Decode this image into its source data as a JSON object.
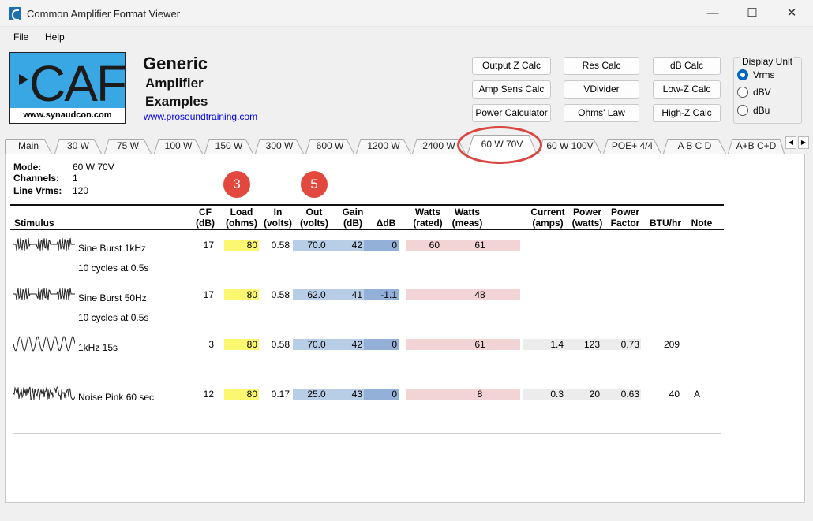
{
  "window": {
    "title": "Common Amplifier Format Viewer",
    "minimize": "—",
    "maximize": "☐",
    "close": "✕"
  },
  "menu": {
    "file": "File",
    "help": "Help"
  },
  "logo": {
    "letters": "CAF",
    "site": "www.synaudcon.com"
  },
  "heading": {
    "line1": "Generic",
    "line2": "Amplifier",
    "line3": "Examples",
    "link": "www.prosoundtraining.com"
  },
  "calc_buttons": [
    "Output Z Calc",
    "Res Calc",
    "dB Calc",
    "Amp Sens Calc",
    "VDivider",
    "Low-Z Calc",
    "Power Calculator",
    "Ohms' Law",
    "High-Z Calc"
  ],
  "display_unit": {
    "title": "Display Unit",
    "options": [
      "Vrms",
      "dBV",
      "dBu"
    ],
    "selected": "Vrms"
  },
  "tabs": [
    "Main",
    "30 W",
    "75 W",
    "100 W",
    "150 W",
    "300 W",
    "600 W",
    "1200 W",
    "2400 W",
    "60 W 70V",
    "60 W 100V",
    "POE+ 4/4",
    "A B C D",
    "A+B C+D"
  ],
  "active_tab": "60 W 70V",
  "meta": {
    "mode_label": "Mode:",
    "mode": "60 W 70V",
    "channels_label": "Channels:",
    "channels": "1",
    "line_label": "Line Vrms:",
    "line": "120"
  },
  "badges": [
    "3",
    "5"
  ],
  "columns": {
    "stimulus": "Stimulus",
    "cf": [
      "CF",
      "(dB)"
    ],
    "load": [
      "Load",
      "(ohms)"
    ],
    "in": [
      "In",
      "(volts)"
    ],
    "out": [
      "Out",
      "(volts)"
    ],
    "gain": [
      "Gain",
      "(dB)"
    ],
    "ddb": [
      "",
      "ΔdB"
    ],
    "watts_rated": [
      "Watts",
      "(rated)"
    ],
    "watts_meas": [
      "Watts",
      "(meas)"
    ],
    "current": [
      "Current",
      "(amps)"
    ],
    "power": [
      "Power",
      "(watts)"
    ],
    "pf": [
      "Power",
      "Factor"
    ],
    "btu": [
      "",
      "BTU/hr"
    ],
    "note": [
      "",
      "Note"
    ]
  },
  "rows": [
    {
      "stimulus": "Sine Burst 1kHz",
      "sub": "10 cycles at 0.5s",
      "wave": "burst",
      "cf": "17",
      "load": "80",
      "in": "0.58",
      "out": "70.0",
      "gain": "42",
      "ddb": "0",
      "watts_rated": "60",
      "watts_meas": "61",
      "current": "",
      "power": "",
      "pf": "",
      "btu": "",
      "note": ""
    },
    {
      "stimulus": "Sine Burst 50Hz",
      "sub": "10 cycles at 0.5s",
      "wave": "burst",
      "cf": "17",
      "load": "80",
      "in": "0.58",
      "out": "62.0",
      "gain": "41",
      "ddb": "-1.1",
      "watts_rated": "",
      "watts_meas": "48",
      "current": "",
      "power": "",
      "pf": "",
      "btu": "",
      "note": ""
    },
    {
      "stimulus": "1kHz 15s",
      "sub": "",
      "wave": "sine",
      "cf": "3",
      "load": "80",
      "in": "0.58",
      "out": "70.0",
      "gain": "42",
      "ddb": "0",
      "watts_rated": "",
      "watts_meas": "61",
      "current": "1.4",
      "power": "123",
      "pf": "0.73",
      "btu": "209",
      "note": ""
    },
    {
      "stimulus": "Noise Pink 60 sec",
      "sub": "",
      "wave": "noise",
      "cf": "12",
      "load": "80",
      "in": "0.17",
      "out": "25.0",
      "gain": "43",
      "ddb": "0",
      "watts_rated": "",
      "watts_meas": "8",
      "current": "0.3",
      "power": "20",
      "pf": "0.63",
      "btu": "40",
      "note": "A"
    }
  ]
}
